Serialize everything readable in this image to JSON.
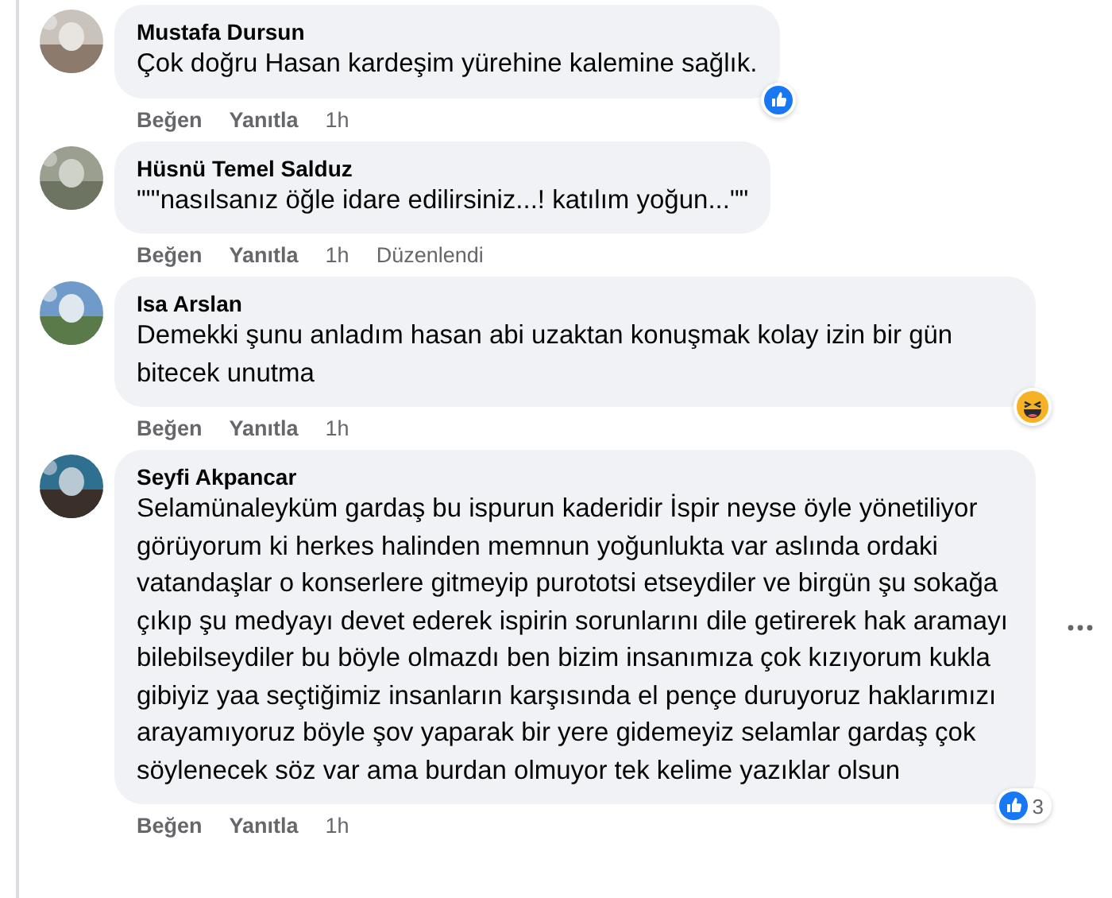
{
  "comments": [
    {
      "author": "Mustafa Dursun",
      "text": "Çok doğru Hasan kardeşim yürehine kalemine sağlık.",
      "actions": {
        "like": "Beğen",
        "reply": "Yanıtla",
        "time": "1h"
      },
      "reaction": {
        "kind": "like"
      },
      "more_menu": false
    },
    {
      "author": "Hüsnü Temel Salduz",
      "text": "\"\"'nasılsanız öğle idare edilirsiniz...! katılım yoğun...\"\"",
      "actions": {
        "like": "Beğen",
        "reply": "Yanıtla",
        "time": "1h",
        "edited": "Düzenlendi"
      },
      "more_menu": false
    },
    {
      "author": "Isa Arslan",
      "text": "Demekki şunu anladım hasan abi uzaktan konuşmak kolay izin bir gün bitecek unutma",
      "actions": {
        "like": "Beğen",
        "reply": "Yanıtla",
        "time": "1h"
      },
      "reaction": {
        "kind": "haha"
      },
      "more_menu": false
    },
    {
      "author": "Seyfi Akpancar",
      "text": "Selamünaleyküm gardaş bu ispurun kaderidir İspir neyse öyle yönetiliyor görüyorum ki herkes halinden memnun yoğunlukta var aslında ordaki vatandaşlar o konserlere gitmeyip purototsi etseydiler ve birgün şu sokağa çıkıp şu medyayı devet ederek ispirin sorunlarını dile getirerek hak aramayı bilebilseydiler bu böyle olmazdı ben bizim insanımıza çok kızıyorum kukla gibiyiz yaa seçtiğimiz insanların karşısında el pençe duruyoruz haklarımızı arayamıyoruz böyle şov yaparak bir yere gidemeyiz selamlar gardaş çok söylenecek söz var ama burdan olmuyor tek kelime yazıklar olsun",
      "actions": {
        "like": "Beğen",
        "reply": "Yanıtla",
        "time": "1h"
      },
      "reaction": {
        "kind": "like",
        "count": "3"
      },
      "more_menu": true
    }
  ]
}
